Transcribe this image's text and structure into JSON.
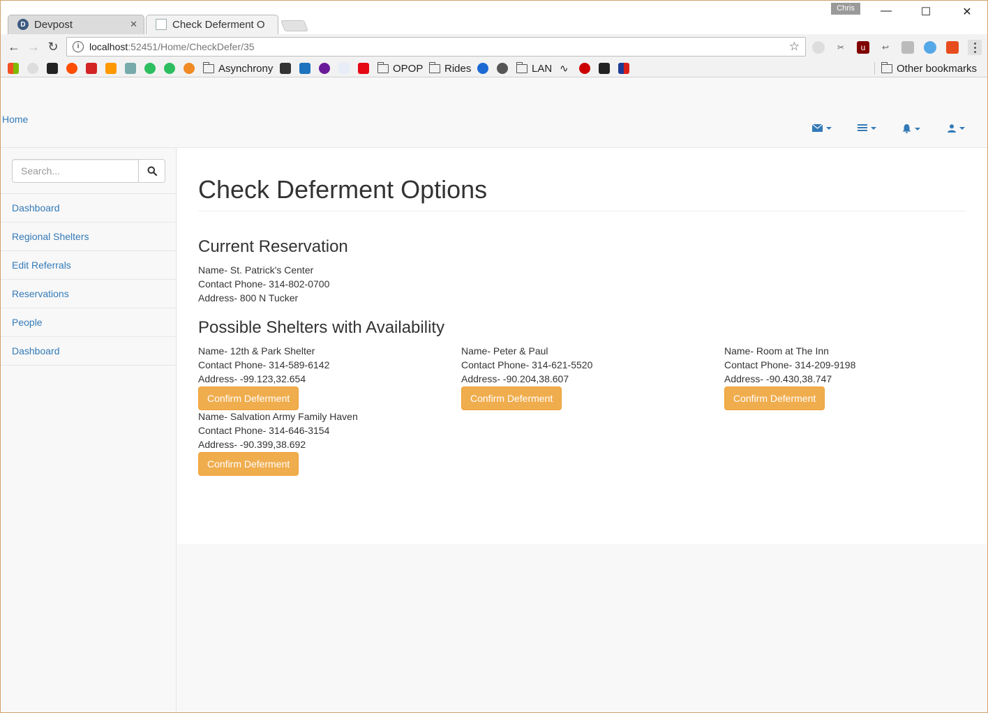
{
  "browser": {
    "tabs": [
      {
        "title": "Devpost",
        "favicon_letter": "D"
      },
      {
        "title": "Check Deferment O"
      }
    ],
    "profile_name": "Chris",
    "url_host": "localhost",
    "url_rest": ":52451/Home/CheckDefer/35",
    "bookmarks": {
      "asynchrony": "Asynchrony",
      "opop": "OPOP",
      "rides": "Rides",
      "lan": "LAN",
      "other": "Other bookmarks"
    }
  },
  "navbar": {
    "home_label": "Home"
  },
  "sidebar": {
    "search_placeholder": "Search...",
    "items": [
      {
        "label": "Dashboard"
      },
      {
        "label": "Regional Shelters"
      },
      {
        "label": "Edit Referrals"
      },
      {
        "label": "Reservations"
      },
      {
        "label": "People"
      },
      {
        "label": "Dashboard"
      }
    ]
  },
  "main": {
    "title": "Check Deferment Options",
    "current_heading": "Current Reservation",
    "current": {
      "name": "Name- St. Patrick's Center",
      "phone": "Contact Phone- 314-802-0700",
      "address": "Address- 800 N Tucker"
    },
    "possible_heading": "Possible Shelters with Availability",
    "shelters": [
      {
        "name": "Name- 12th & Park Shelter",
        "phone": "Contact Phone- 314-589-6142",
        "address": "Address- -99.123,32.654",
        "button": "Confirm Deferment"
      },
      {
        "name": "Name- Peter & Paul",
        "phone": "Contact Phone- 314-621-5520",
        "address": "Address- -90.204,38.607",
        "button": "Confirm Deferment"
      },
      {
        "name": "Name- Room at The Inn",
        "phone": "Contact Phone- 314-209-9198",
        "address": "Address- -90.430,38.747",
        "button": "Confirm Deferment"
      },
      {
        "name": "Name- Salvation Army Family Haven",
        "phone": "Contact Phone- 314-646-3154",
        "address": "Address- -90.399,38.692",
        "button": "Confirm Deferment"
      }
    ]
  },
  "colors": {
    "link": "#337ab7",
    "warning_button": "#f0ad4e"
  }
}
